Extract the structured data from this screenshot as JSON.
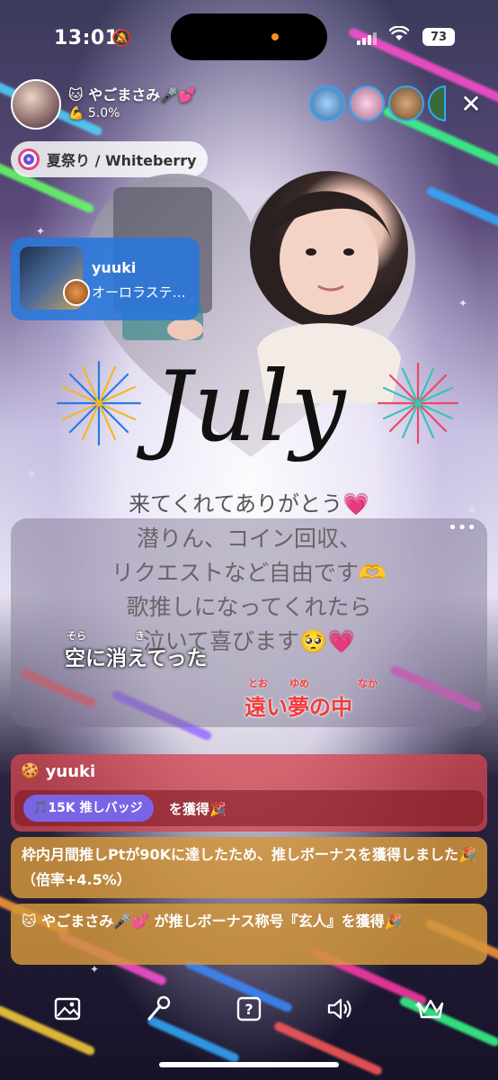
{
  "status_bar": {
    "time": "13:01",
    "battery": "73"
  },
  "host": {
    "name": "🐱 やごまさみ🎤💕",
    "rate": "💪 5.0%"
  },
  "song_pill": {
    "label": "夏祭り / Whiteberry"
  },
  "now_playing": {
    "user": "yuuki",
    "song": "オーロラステ…"
  },
  "overlay": {
    "july_text": "July"
  },
  "notice": {
    "thanks": "来てくれてありがとう💗",
    "lines": [
      "潜りん、コイン回収、",
      "リクエストなど自由です🫶",
      "歌推しになってくれたら",
      "泣いて喜びます🥺💗"
    ],
    "more": "•••"
  },
  "lyrics": {
    "line1": "空に消えてった",
    "line1_ruby": [
      "そら",
      "き"
    ],
    "line2": "遠い夢の中",
    "line2_ruby": [
      "とお",
      "ゆめ",
      "なか"
    ]
  },
  "comments": {
    "gift": {
      "user": "🍪 yuuki",
      "badge": "🎵15K 推しバッジ",
      "suffix": "を獲得🎉"
    },
    "bonus": "枠内月間推しPtが90Kに達したため、推しボーナスを獲得しました🎉（倍率+4.5%）",
    "title": "🐱 やごまさみ🎤💕 が推しボーナス称号『玄人』を獲得🎉"
  },
  "bottom_bar": {
    "icons": [
      "image-icon",
      "microphone-icon",
      "question-icon",
      "speaker-icon",
      "crown-icon"
    ]
  }
}
